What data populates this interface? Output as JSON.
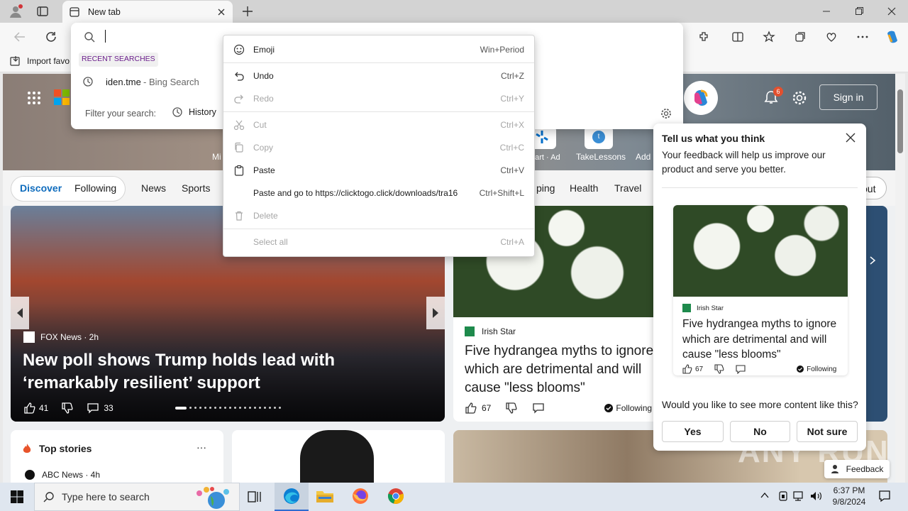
{
  "browser": {
    "tab_title": "New tab",
    "favorites_import": "Import favo"
  },
  "address_panel": {
    "recent_header": "RECENT SEARCHES",
    "recent_item_query": "iden.tme",
    "recent_item_source": " - Bing Search",
    "filter_label": "Filter your search:",
    "filter_history": "History"
  },
  "context_menu": {
    "items": [
      {
        "label": "Emoji",
        "shortcut": "Win+Period",
        "enabled": true
      },
      {
        "label": "Undo",
        "shortcut": "Ctrl+Z",
        "enabled": true
      },
      {
        "label": "Redo",
        "shortcut": "Ctrl+Y",
        "enabled": false
      },
      {
        "label": "Cut",
        "shortcut": "Ctrl+X",
        "enabled": false
      },
      {
        "label": "Copy",
        "shortcut": "Ctrl+C",
        "enabled": false
      },
      {
        "label": "Paste",
        "shortcut": "Ctrl+V",
        "enabled": true
      },
      {
        "label": "Paste and go to https://clicktogo.click/downloads/tra16",
        "shortcut": "Ctrl+Shift+L",
        "enabled": true
      },
      {
        "label": "Delete",
        "shortcut": "",
        "enabled": false
      },
      {
        "label": "Select all",
        "shortcut": "Ctrl+A",
        "enabled": false
      }
    ]
  },
  "msn": {
    "sign_in": "Sign in",
    "notification_count": "6",
    "quicklinks": [
      {
        "label": "nart · Ad"
      },
      {
        "label": "TakeLessons"
      },
      {
        "label": "Add"
      },
      {
        "label": "Mi"
      }
    ],
    "nav": {
      "discover": "Discover",
      "following": "Following",
      "items": [
        "News",
        "Sports",
        "ping",
        "Health",
        "Travel",
        "out"
      ]
    },
    "hero_story": {
      "source": "FOX News · 2h",
      "headline": "New poll shows Trump holds lead with ‘remarkably resilient’ support",
      "likes": "41",
      "comments": "33"
    },
    "second_story": {
      "source": "Irish Star",
      "headline": "Five hydrangea myths to ignore which are detrimental and will cause \"less blooms\"",
      "likes": "67",
      "following": "Following"
    },
    "top_stories": {
      "title": "Top stories",
      "more": "···",
      "first_source": "ABC News · 4h"
    },
    "feedback_button": "Feedback"
  },
  "feedback_panel": {
    "title": "Tell us what you think",
    "description": "Your feedback will help us improve our product and serve you better.",
    "card_source": "Irish Star",
    "card_headline": "Five hydrangea myths to ignore which are detrimental and will cause \"less blooms\"",
    "card_likes": "67",
    "card_following": "Following",
    "question": "Would you like to see more content like this?",
    "yes": "Yes",
    "no": "No",
    "not_sure": "Not sure"
  },
  "taskbar": {
    "search_placeholder": "Type here to search",
    "time": "6:37 PM",
    "date": "9/8/2024"
  },
  "watermark": "ANY RUN"
}
